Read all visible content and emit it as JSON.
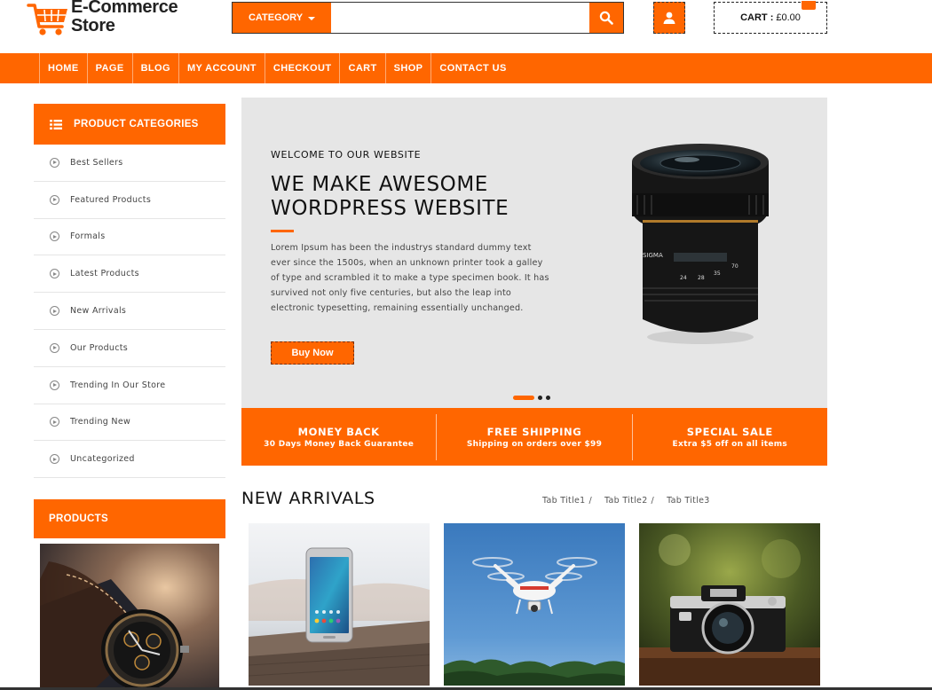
{
  "brand": {
    "line1": "E-Commerce",
    "line2": "Store"
  },
  "search": {
    "category_label": "CATEGORY",
    "placeholder": ""
  },
  "cart": {
    "label": "CART :",
    "amount": "£0.00"
  },
  "nav": [
    "HOME",
    "PAGE",
    "BLOG",
    "MY ACCOUNT",
    "CHECKOUT",
    "CART",
    "SHOP",
    "CONTACT US"
  ],
  "sidebar": {
    "categories_heading": "PRODUCT CATEGORIES",
    "categories": [
      "Best Sellers",
      "Featured Products",
      "Formals",
      "Latest Products",
      "New Arrivals",
      "Our Products",
      "Trending In Our Store",
      "Trending New",
      "Uncategorized"
    ],
    "products_heading": "PRODUCTS"
  },
  "hero": {
    "kicker": "WELCOME TO OUR WEBSITE",
    "title": "WE MAKE AWESOME WORDPRESS WEBSITE",
    "text": "Lorem Ipsum has been the industrys standard dummy text ever since the 1500s, when an unknown printer took a galley of type and scrambled it to make a type specimen book. It has survived not only five centuries, but also the leap into electronic typesetting, remaining essentially unchanged.",
    "button": "Buy Now",
    "lens_text": "SIGMA"
  },
  "features": [
    {
      "title": "MONEY BACK",
      "sub": "30 Days Money Back Guarantee"
    },
    {
      "title": "FREE SHIPPING",
      "sub": "Shipping on orders over $99"
    },
    {
      "title": "SPECIAL SALE",
      "sub": "Extra $5 off on all items"
    }
  ],
  "arrivals": {
    "title": "NEW ARRIVALS",
    "tabs": [
      "Tab Title1",
      "Tab Title2",
      "Tab Title3"
    ]
  },
  "colors": {
    "accent": "#ff6600",
    "hero_bg": "#e6e6e6"
  }
}
